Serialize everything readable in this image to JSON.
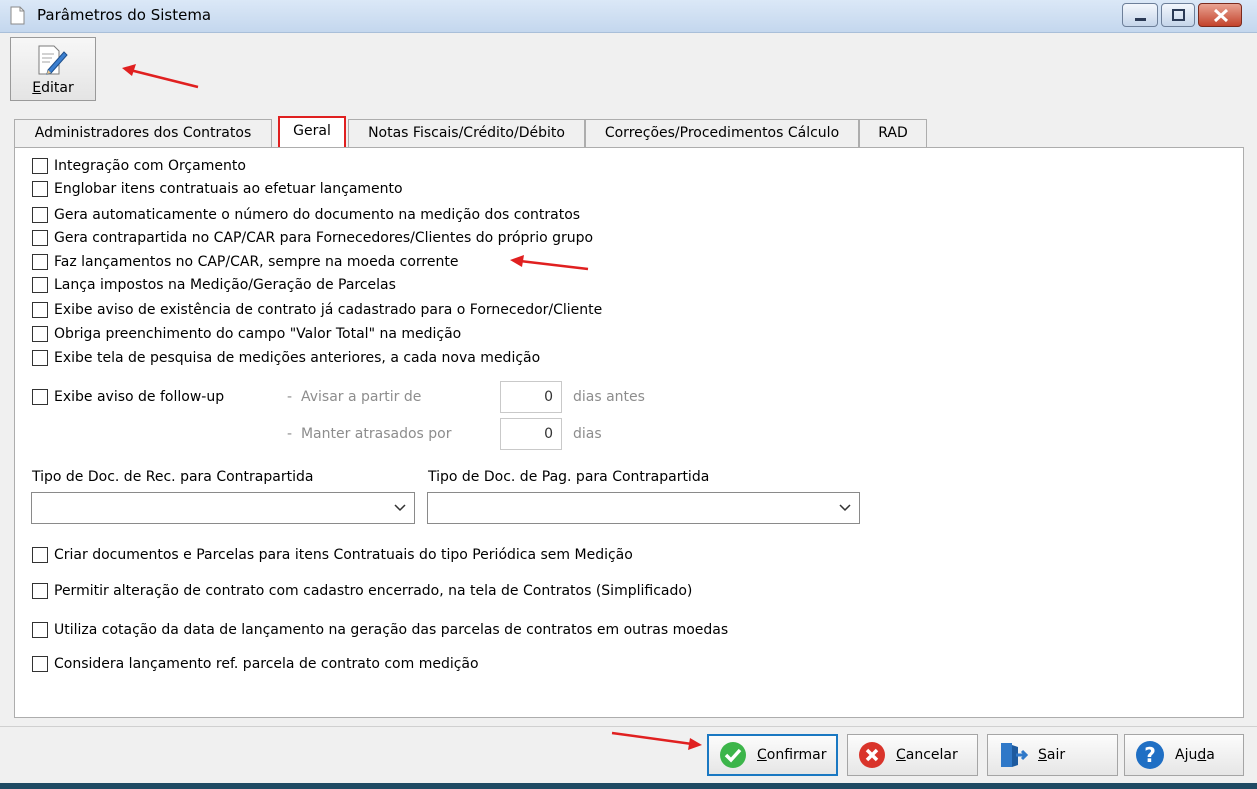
{
  "window": {
    "title": "Parâmetros do Sistema"
  },
  "toolbar": {
    "edit_label_u": "E",
    "edit_label_rest": "ditar"
  },
  "tabs": [
    {
      "label": "Administradores dos Contratos"
    },
    {
      "label": "Geral"
    },
    {
      "label": "Notas Fiscais/Crédito/Débito"
    },
    {
      "label": "Correções/Procedimentos Cálculo"
    },
    {
      "label": "RAD"
    }
  ],
  "active_tab": "Geral",
  "checkboxes": [
    {
      "label": "Integração com Orçamento",
      "checked": false
    },
    {
      "label": "Englobar itens contratuais ao efetuar lançamento",
      "checked": false
    },
    {
      "label": "Gera automaticamente o número do documento na medição dos contratos",
      "checked": false
    },
    {
      "label": "Gera contrapartida no CAP/CAR para Fornecedores/Clientes do próprio grupo",
      "checked": false
    },
    {
      "label": "Faz lançamentos no CAP/CAR, sempre na moeda corrente",
      "checked": false
    },
    {
      "label": "Lança impostos na Medição/Geração de Parcelas",
      "checked": false
    },
    {
      "label": "Exibe aviso de existência de contrato já cadastrado para o Fornecedor/Cliente",
      "checked": false
    },
    {
      "label": "Obriga preenchimento do campo \"Valor Total\" na medição",
      "checked": false
    },
    {
      "label": "Exibe tela de pesquisa de medições anteriores, a cada nova medição",
      "checked": false
    }
  ],
  "followup": {
    "label": "Exibe aviso de follow-up",
    "checked": false,
    "dash": "-",
    "avisar_label": "Avisar a partir de",
    "avisar_value": "0",
    "avisar_suffix": "dias antes",
    "manter_label": "Manter atrasados por",
    "manter_value": "0",
    "manter_suffix": "dias"
  },
  "contrapartida": {
    "rec_label": "Tipo de Doc. de Rec. para Contrapartida",
    "rec_value": "",
    "pag_label": "Tipo de Doc. de Pag. para Contrapartida",
    "pag_value": ""
  },
  "checkboxes2": [
    {
      "label": "Criar documentos e Parcelas para itens Contratuais do tipo Periódica sem Medição",
      "checked": false
    },
    {
      "label": "Permitir alteração de contrato com cadastro encerrado, na tela de Contratos (Simplificado)",
      "checked": false
    },
    {
      "label": "Utiliza cotação da data de lançamento na geração das parcelas de contratos em outras moedas",
      "checked": false
    },
    {
      "label": "Considera lançamento ref. parcela de contrato com medição",
      "checked": false
    }
  ],
  "buttons": {
    "confirmar": {
      "u": "C",
      "rest": "onfirmar"
    },
    "cancelar": {
      "u": "C",
      "rest": "ancelar"
    },
    "sair": {
      "u": "S",
      "rest": "air"
    },
    "ajuda": {
      "pre": "Aju",
      "u": "d",
      "post": "a"
    }
  },
  "colors": {
    "annotation": "#e02020",
    "focus": "#1a78c2",
    "confirm_green": "#3cb54a",
    "cancel_red": "#d9342b",
    "help_blue": "#1f6fc4"
  }
}
